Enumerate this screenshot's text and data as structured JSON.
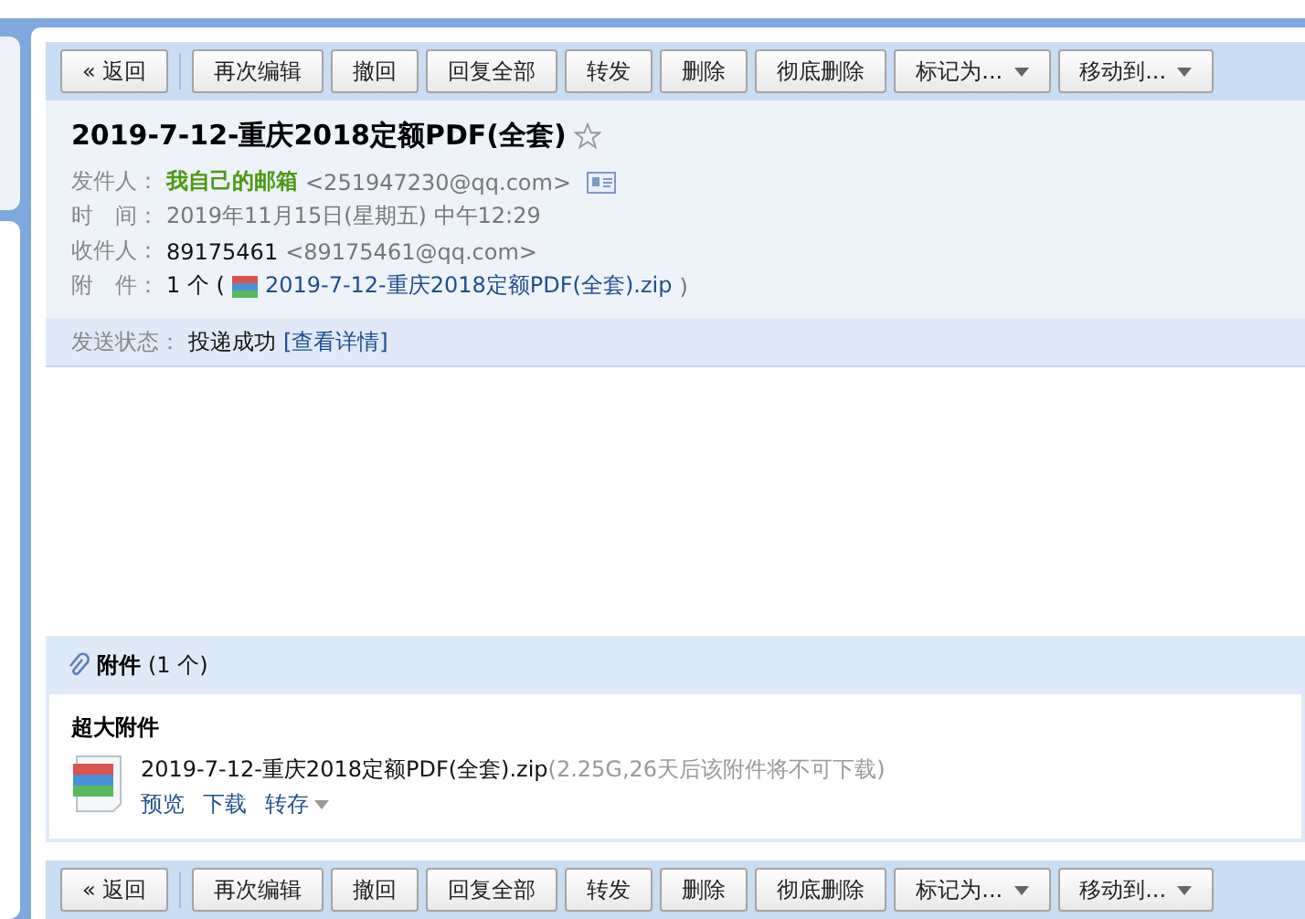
{
  "toolbars": [
    {
      "buttons": [
        {
          "label": "« 返回",
          "kind": "plain"
        },
        {
          "label": "再次编辑",
          "kind": "plain"
        },
        {
          "label": "撤回",
          "kind": "plain"
        },
        {
          "label": "回复全部",
          "kind": "plain"
        },
        {
          "label": "转发",
          "kind": "plain"
        },
        {
          "label": "删除",
          "kind": "plain"
        },
        {
          "label": "彻底删除",
          "kind": "plain"
        },
        {
          "label": "标记为...",
          "kind": "dropdown"
        },
        {
          "label": "移动到...",
          "kind": "dropdown"
        }
      ]
    },
    {
      "buttons": [
        {
          "label": "« 返回",
          "kind": "plain"
        },
        {
          "label": "再次编辑",
          "kind": "plain"
        },
        {
          "label": "撤回",
          "kind": "plain"
        },
        {
          "label": "回复全部",
          "kind": "plain"
        },
        {
          "label": "转发",
          "kind": "plain"
        },
        {
          "label": "删除",
          "kind": "plain"
        },
        {
          "label": "彻底删除",
          "kind": "plain"
        },
        {
          "label": "标记为...",
          "kind": "dropdown"
        },
        {
          "label": "移动到...",
          "kind": "dropdown"
        }
      ]
    }
  ],
  "header": {
    "subject": "2019-7-12-重庆2018定额PDF(全套)",
    "starred": false,
    "sender": {
      "label": "发件人：",
      "name": "我自己的邮箱",
      "email": "<251947230@qq.com>"
    },
    "time": {
      "label": "时　间：",
      "value": "2019年11月15日(星期五) 中午12:29"
    },
    "recipient": {
      "label": "收件人：",
      "name": "89175461",
      "email": "<89175461@qq.com>"
    },
    "attachment": {
      "label": "附　件：",
      "count": "1 个 (",
      "file": "2019-7-12-重庆2018定额PDF(全套).zip",
      "close": ")"
    }
  },
  "status": {
    "label": "发送状态：",
    "value": "投递成功",
    "link": "[查看详情]"
  },
  "attachments": {
    "title": "附件",
    "count": "(1 个)",
    "group": "超大附件",
    "file": {
      "name": "2019-7-12-重庆2018定额PDF(全套).zip",
      "info": "(2.25G,26天后该附件将不可下载)",
      "actions": [
        {
          "label": "预览",
          "kind": "link"
        },
        {
          "label": "下载",
          "kind": "link"
        },
        {
          "label": "转存",
          "kind": "dropdown"
        }
      ]
    }
  }
}
